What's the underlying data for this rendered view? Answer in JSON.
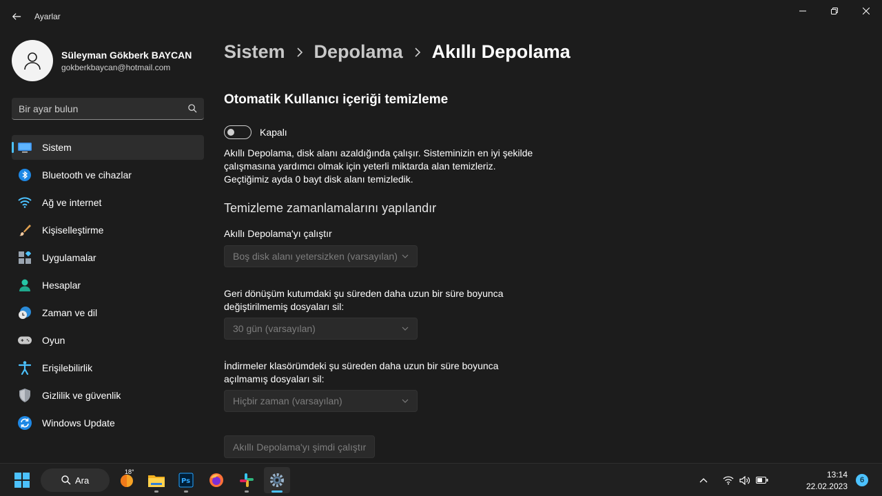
{
  "window": {
    "title": "Ayarlar"
  },
  "profile": {
    "name": "Süleyman Gökberk BAYCAN",
    "email": "gokberkbaycan@hotmail.com"
  },
  "search": {
    "placeholder": "Bir ayar bulun"
  },
  "sidebar": {
    "items": [
      {
        "label": "Sistem",
        "icon": "monitor-icon",
        "active": true
      },
      {
        "label": "Bluetooth ve cihazlar",
        "icon": "bluetooth-icon"
      },
      {
        "label": "Ağ ve internet",
        "icon": "wifi-icon"
      },
      {
        "label": "Kişiselleştirme",
        "icon": "brush-icon"
      },
      {
        "label": "Uygulamalar",
        "icon": "apps-icon"
      },
      {
        "label": "Hesaplar",
        "icon": "person-icon"
      },
      {
        "label": "Zaman ve dil",
        "icon": "clock-globe-icon"
      },
      {
        "label": "Oyun",
        "icon": "gamepad-icon"
      },
      {
        "label": "Erişilebilirlik",
        "icon": "accessibility-icon"
      },
      {
        "label": "Gizlilik ve güvenlik",
        "icon": "shield-icon"
      },
      {
        "label": "Windows Update",
        "icon": "update-icon"
      }
    ]
  },
  "breadcrumb": {
    "level1": "Sistem",
    "level2": "Depolama",
    "current": "Akıllı Depolama"
  },
  "main": {
    "section_title": "Otomatik Kullanıcı içeriği temizleme",
    "toggle_label": "Kapalı",
    "toggle_on": false,
    "description_line1": "Akıllı Depolama, disk alanı azaldığında çalışır. Sisteminizin en iyi şekilde",
    "description_line2": "çalışmasına yardımcı olmak için yeterli miktarda alan temizleriz.",
    "description_line3": "Geçtiğimiz ayda 0 bayt disk alanı temizledik.",
    "schedule_title": "Temizleme zamanlamalarını yapılandır",
    "run_label": "Akıllı Depolama'yı çalıştır",
    "run_value": "Boş disk alanı yetersizken (varsayılan)",
    "recycle_label_line1": "Geri dönüşüm kutumdaki şu süreden daha uzun bir süre boyunca",
    "recycle_label_line2": "değiştirilmemiş dosyaları sil:",
    "recycle_value": "30 gün (varsayılan)",
    "downloads_label_line1": "İndirmeler klasörümdeki şu süreden daha uzun bir süre boyunca",
    "downloads_label_line2": "açılmamış dosyaları sil:",
    "downloads_value": "Hiçbir zaman (varsayılan)",
    "run_now_button": "Akıllı Depolama'yı şimdi çalıştır"
  },
  "taskbar": {
    "search_label": "Ara",
    "weather_temp": "18°",
    "time": "13:14",
    "date": "22.02.2023",
    "notification_count": "6"
  },
  "colors": {
    "accent": "#4cc2ff",
    "background": "#1c1c1c",
    "card": "#2d2d2d"
  }
}
